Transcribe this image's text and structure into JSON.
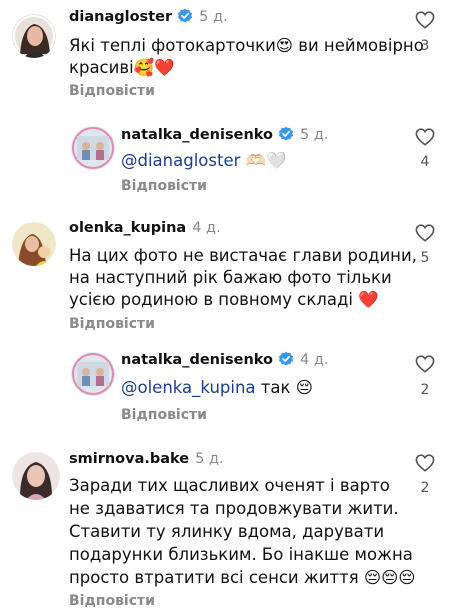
{
  "labels": {
    "reply": "Відповісти"
  },
  "colors": {
    "verified_badge": "#3897f0",
    "mention": "#1d3d8f",
    "secondary_text": "#8a8a8a",
    "like_heart_filled": "#e0245e"
  },
  "comments": [
    {
      "username": "dianagloster",
      "verified": true,
      "time": "5 д.",
      "lines": [
        "Які теплі фотокарточки😍 ви неймовірно",
        "красиві🥰❤️"
      ],
      "likes": "3",
      "avatar_icon": "woman-portrait-avatar"
    },
    {
      "username": "natalka_denisenko",
      "verified": true,
      "time": "5 д.",
      "mention": "@dianagloster",
      "after_mention": " 🫶🏻🤍",
      "likes": "4",
      "avatar_icon": "family-photo-avatar"
    },
    {
      "username": "olenka_kupina",
      "verified": false,
      "time": "4 д.",
      "lines": [
        "На цих фото не вистачає глави родини,",
        "на наступний рік бажаю фото тільки",
        "усією родиною в повному складі ❤️"
      ],
      "likes": "5",
      "avatar_icon": "woman-with-child-avatar"
    },
    {
      "username": "natalka_denisenko",
      "verified": true,
      "time": "4 д.",
      "mention": "@olenka_kupina",
      "after_mention": " так 😔",
      "likes": "2",
      "avatar_icon": "family-photo-avatar"
    },
    {
      "username": "smirnova.bake",
      "verified": false,
      "time": "5 д.",
      "lines": [
        "Заради тих щасливих оченят і варто",
        "не здаватися та продовжувати жити.",
        "Ставити ту ялинку вдома, дарувати",
        "подарунки близьким. Бо інакше можна",
        "просто втратити всі сенси життя 😔😔😔"
      ],
      "likes": "2",
      "avatar_icon": "woman-portrait-avatar"
    }
  ]
}
